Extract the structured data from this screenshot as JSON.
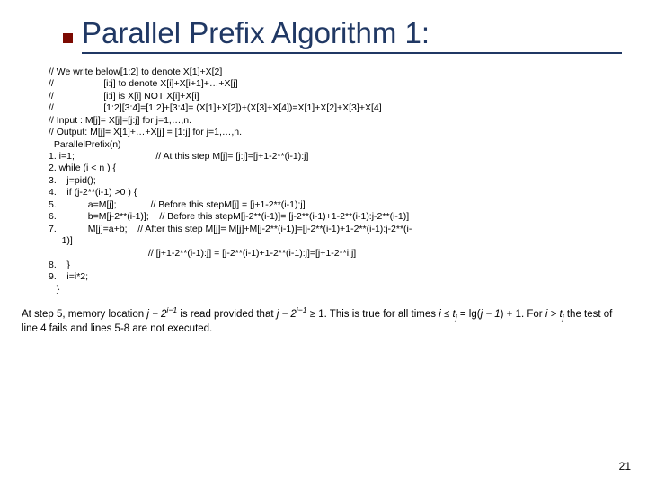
{
  "title": "Parallel Prefix Algorithm 1:",
  "code": "// We write below[1:2] to denote X[1]+X[2]\n//                   [i:j] to denote X[i]+X[i+1]+…+X[j]\n//                   [i:i] is X[i] NOT X[i]+X[i]\n//                   [1:2][3:4]=[1:2]+[3:4]= (X[1]+X[2])+(X[3]+X[4])=X[1]+X[2]+X[3]+X[4]\n// Input : M[j]= X[j]=[j:j] for j=1,…,n.\n// Output: M[j]= X[1]+…+X[j] = [1:j] for j=1,…,n.\n  ParallelPrefix(n)\n1. i=1;                               // At this step M[j]= [j:j]=[j+1-2**(i-1):j]\n2. while (i < n ) {\n3.    j=pid();\n4.    if (j-2**(i-1) >0 ) {\n5.            a=M[j];             // Before this stepM[j] = [j+1-2**(i-1):j]\n6.            b=M[j-2**(i-1)];    // Before this stepM[j-2**(i-1)]= [j-2**(i-1)+1-2**(i-1):j-2**(i-1)]\n7.            M[j]=a+b;    // After this step M[j]= M[j]+M[j-2**(i-1)]=[j-2**(i-1)+1-2**(i-1):j-2**(i-\n     1)]\n                                      // [j+1-2**(i-1):j] = [j-2**(i-1)+1-2**(i-1):j]=[j+1-2**i:j]\n8.    }\n9.    i=i*2;\n   }",
  "caption_pre": "At step 5, memory location ",
  "caption_jm": "j − 2",
  "caption_exp1": "i−1",
  "caption_mid": " is read provided that ",
  "caption_jm2": "j − 2",
  "caption_exp2": "i−1",
  "caption_ge": " ≥ 1. This is true for all times ",
  "caption_ile": "i ≤ t",
  "caption_sub_j1": "j",
  "caption_eq": " = lg(",
  "caption_jminus1": "j − 1",
  "caption_plus": ") + 1. For ",
  "caption_igt": "i > t",
  "caption_sub_j2": "j",
  "caption_tail": " the test of line 4 fails and lines 5-8 are not executed.",
  "page": "21"
}
